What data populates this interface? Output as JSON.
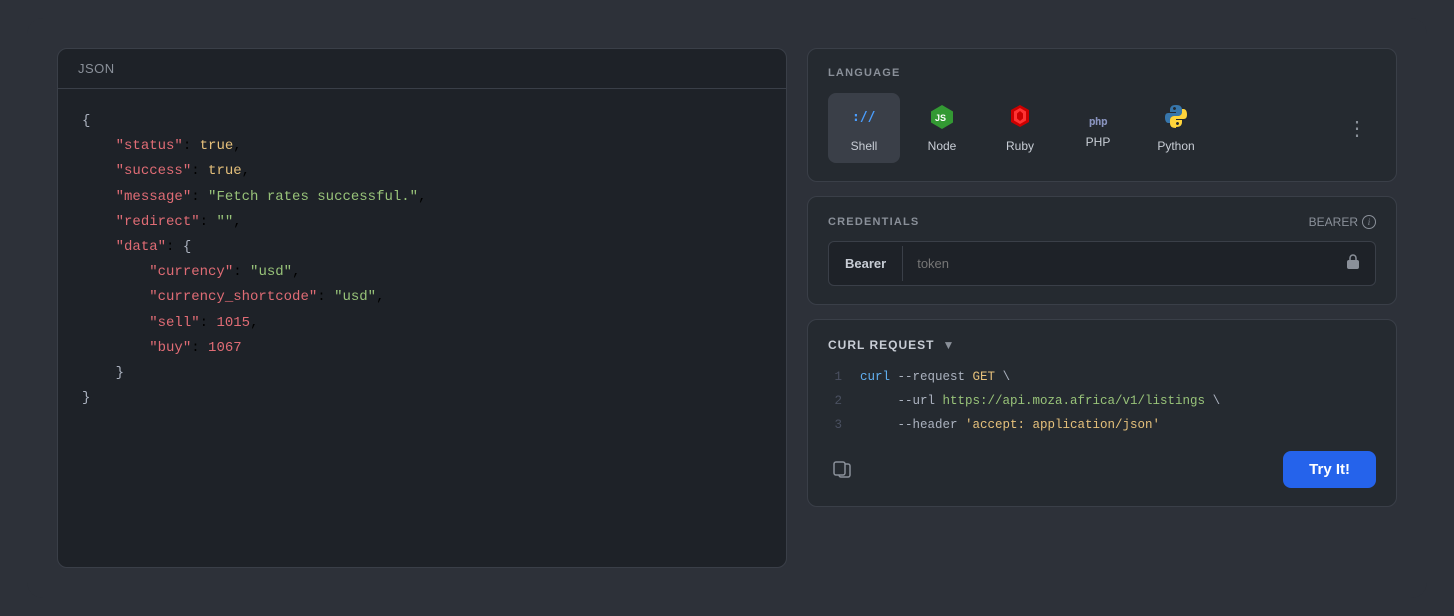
{
  "left_panel": {
    "header": "JSON",
    "json_lines": [
      {
        "type": "brace",
        "text": "{"
      },
      {
        "type": "key-bool",
        "key": "\"status\"",
        "colon": ": ",
        "value": "true",
        "comma": ","
      },
      {
        "type": "key-bool",
        "key": "\"success\"",
        "colon": ": ",
        "value": "true",
        "comma": ","
      },
      {
        "type": "key-string",
        "key": "\"message\"",
        "colon": ": ",
        "value": "\"Fetch rates successful.\"",
        "comma": ","
      },
      {
        "type": "key-string",
        "key": "\"redirect\"",
        "colon": ": ",
        "value": "\"\"",
        "comma": ","
      },
      {
        "type": "key-obj-open",
        "key": "\"data\"",
        "colon": ": {"
      },
      {
        "type": "key-string-inner",
        "key": "\"currency\"",
        "colon": ": ",
        "value": "\"usd\"",
        "comma": ","
      },
      {
        "type": "key-string-inner",
        "key": "\"currency_shortcode\"",
        "colon": ": ",
        "value": "\"usd\"",
        "comma": ","
      },
      {
        "type": "key-number-inner",
        "key": "\"sell\"",
        "colon": ": ",
        "value": "1015",
        "comma": ","
      },
      {
        "type": "key-number-inner",
        "key": "\"buy\"",
        "colon": ": ",
        "value": "1067"
      },
      {
        "type": "inner-brace",
        "text": "    }"
      },
      {
        "type": "brace",
        "text": "}"
      }
    ]
  },
  "right_panel": {
    "language_section": {
      "label": "LANGUAGE",
      "tabs": [
        {
          "id": "shell",
          "name": "Shell",
          "icon": "shell",
          "active": true
        },
        {
          "id": "node",
          "name": "Node",
          "icon": "node",
          "active": false
        },
        {
          "id": "ruby",
          "name": "Ruby",
          "icon": "ruby",
          "active": false
        },
        {
          "id": "php",
          "name": "PHP",
          "icon": "php",
          "active": false
        },
        {
          "id": "python",
          "name": "Python",
          "icon": "python",
          "active": false
        }
      ],
      "more_label": "⋮"
    },
    "credentials_section": {
      "label": "CREDENTIALS",
      "bearer_label": "BEARER",
      "bearer_tab": "Bearer",
      "token_placeholder": "token"
    },
    "curl_section": {
      "label": "CURL REQUEST",
      "lines": [
        {
          "num": "1",
          "content": "curl --request GET \\"
        },
        {
          "num": "2",
          "content": "     --url https://api.moza.africa/v1/listings \\"
        },
        {
          "num": "3",
          "content": "     --header 'accept: application/json'"
        }
      ],
      "try_label": "Try It!"
    }
  }
}
